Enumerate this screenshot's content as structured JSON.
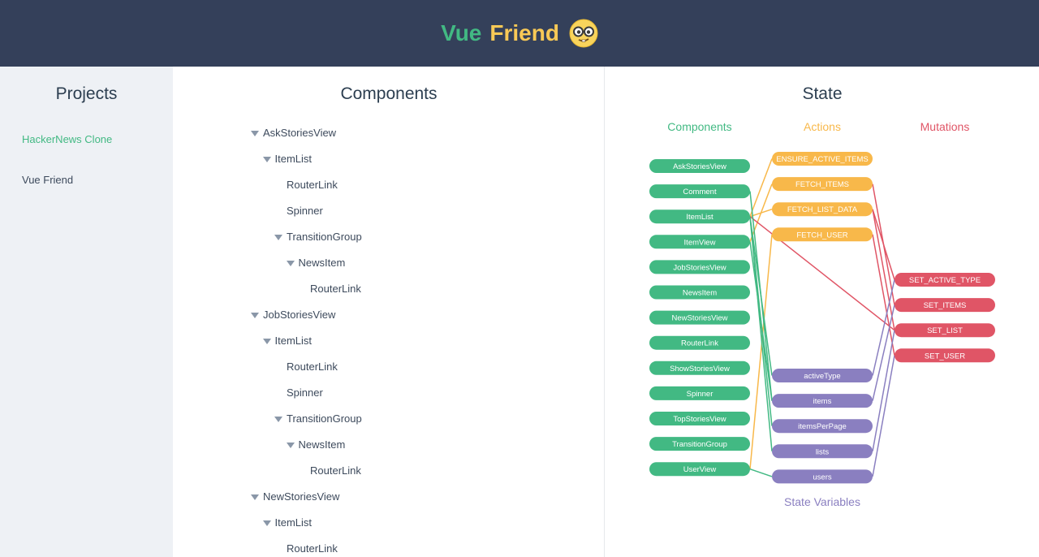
{
  "header": {
    "title_part1": "Vue",
    "title_part2": "Friend",
    "emoji_icon": "nerd-face-icon"
  },
  "sidebar": {
    "heading": "Projects",
    "projects": [
      {
        "label": "HackerNews Clone",
        "active": true
      },
      {
        "label": "Vue Friend",
        "active": false
      }
    ]
  },
  "components_panel": {
    "heading": "Components",
    "tree": [
      {
        "label": "AskStoriesView",
        "depth": 0,
        "expandable": true
      },
      {
        "label": "ItemList",
        "depth": 1,
        "expandable": true
      },
      {
        "label": "RouterLink",
        "depth": 2,
        "expandable": false
      },
      {
        "label": "Spinner",
        "depth": 2,
        "expandable": false
      },
      {
        "label": "TransitionGroup",
        "depth": 2,
        "expandable": true
      },
      {
        "label": "NewsItem",
        "depth": 3,
        "expandable": true
      },
      {
        "label": "RouterLink",
        "depth": 4,
        "expandable": false
      },
      {
        "label": "JobStoriesView",
        "depth": 0,
        "expandable": true
      },
      {
        "label": "ItemList",
        "depth": 1,
        "expandable": true
      },
      {
        "label": "RouterLink",
        "depth": 2,
        "expandable": false
      },
      {
        "label": "Spinner",
        "depth": 2,
        "expandable": false
      },
      {
        "label": "TransitionGroup",
        "depth": 2,
        "expandable": true
      },
      {
        "label": "NewsItem",
        "depth": 3,
        "expandable": true
      },
      {
        "label": "RouterLink",
        "depth": 4,
        "expandable": false
      },
      {
        "label": "NewStoriesView",
        "depth": 0,
        "expandable": true
      },
      {
        "label": "ItemList",
        "depth": 1,
        "expandable": true
      },
      {
        "label": "RouterLink",
        "depth": 2,
        "expandable": false
      }
    ]
  },
  "state_panel": {
    "heading": "State",
    "column_headers": {
      "components": "Components",
      "actions": "Actions",
      "mutations": "Mutations"
    },
    "state_variables_label": "State Variables",
    "colors": {
      "components": "#42b983",
      "actions": "#f8b84a",
      "mutations": "#e05566",
      "state_vars": "#8a7fc0"
    },
    "components": [
      "AskStoriesView",
      "Comment",
      "ItemList",
      "ItemView",
      "JobStoriesView",
      "NewsItem",
      "NewStoriesView",
      "RouterLink",
      "ShowStoriesView",
      "Spinner",
      "TopStoriesView",
      "TransitionGroup",
      "UserView"
    ],
    "actions": [
      "ENSURE_ACTIVE_ITEMS",
      "FETCH_ITEMS",
      "FETCH_LIST_DATA",
      "FETCH_USER"
    ],
    "mutations": [
      "SET_ACTIVE_TYPE",
      "SET_ITEMS",
      "SET_LIST",
      "SET_USER"
    ],
    "state_vars": [
      "activeType",
      "items",
      "itemsPerPage",
      "lists",
      "users"
    ],
    "links": {
      "component_action": [
        [
          "ItemList",
          "ENSURE_ACTIVE_ITEMS"
        ],
        [
          "ItemList",
          "FETCH_LIST_DATA"
        ],
        [
          "ItemView",
          "FETCH_ITEMS"
        ],
        [
          "UserView",
          "FETCH_USER"
        ]
      ],
      "component_mutation": [
        [
          "ItemList",
          "SET_LIST"
        ]
      ],
      "component_state": [
        [
          "Comment",
          "items"
        ],
        [
          "ItemList",
          "activeType"
        ],
        [
          "ItemList",
          "itemsPerPage"
        ],
        [
          "ItemList",
          "lists"
        ],
        [
          "ItemView",
          "items"
        ],
        [
          "UserView",
          "users"
        ]
      ],
      "action_mutation": [
        [
          "FETCH_ITEMS",
          "SET_ITEMS"
        ],
        [
          "FETCH_LIST_DATA",
          "SET_ACTIVE_TYPE"
        ],
        [
          "FETCH_LIST_DATA",
          "SET_LIST"
        ],
        [
          "FETCH_USER",
          "SET_USER"
        ]
      ],
      "state_mutation": [
        [
          "activeType",
          "SET_ACTIVE_TYPE"
        ],
        [
          "items",
          "SET_ITEMS"
        ],
        [
          "lists",
          "SET_LIST"
        ],
        [
          "users",
          "SET_USER"
        ]
      ]
    }
  }
}
